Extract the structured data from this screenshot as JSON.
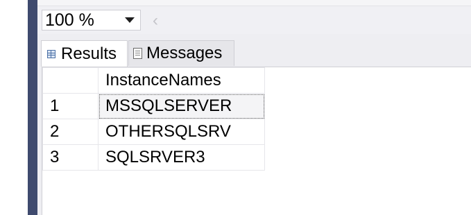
{
  "zoom": {
    "value": "100 %",
    "icon": "chevron-down-icon"
  },
  "scroll": {
    "icon": "chevron-left-icon"
  },
  "tabs": [
    {
      "label": "Results",
      "icon": "grid-icon",
      "active": true
    },
    {
      "label": "Messages",
      "icon": "message-icon",
      "active": false
    }
  ],
  "results": {
    "columns": [
      "InstanceNames"
    ],
    "rows": [
      {
        "num": "1",
        "cells": [
          "MSSQLSERVER"
        ]
      },
      {
        "num": "2",
        "cells": [
          "OTHERSQLSRV"
        ]
      },
      {
        "num": "3",
        "cells": [
          "SQLSRVER3"
        ]
      }
    ],
    "selected_row": 0
  },
  "colors": {
    "sidebar": "#3f4a6e",
    "pane": "#eeeef2",
    "grid_line": "#e6e6ea"
  }
}
